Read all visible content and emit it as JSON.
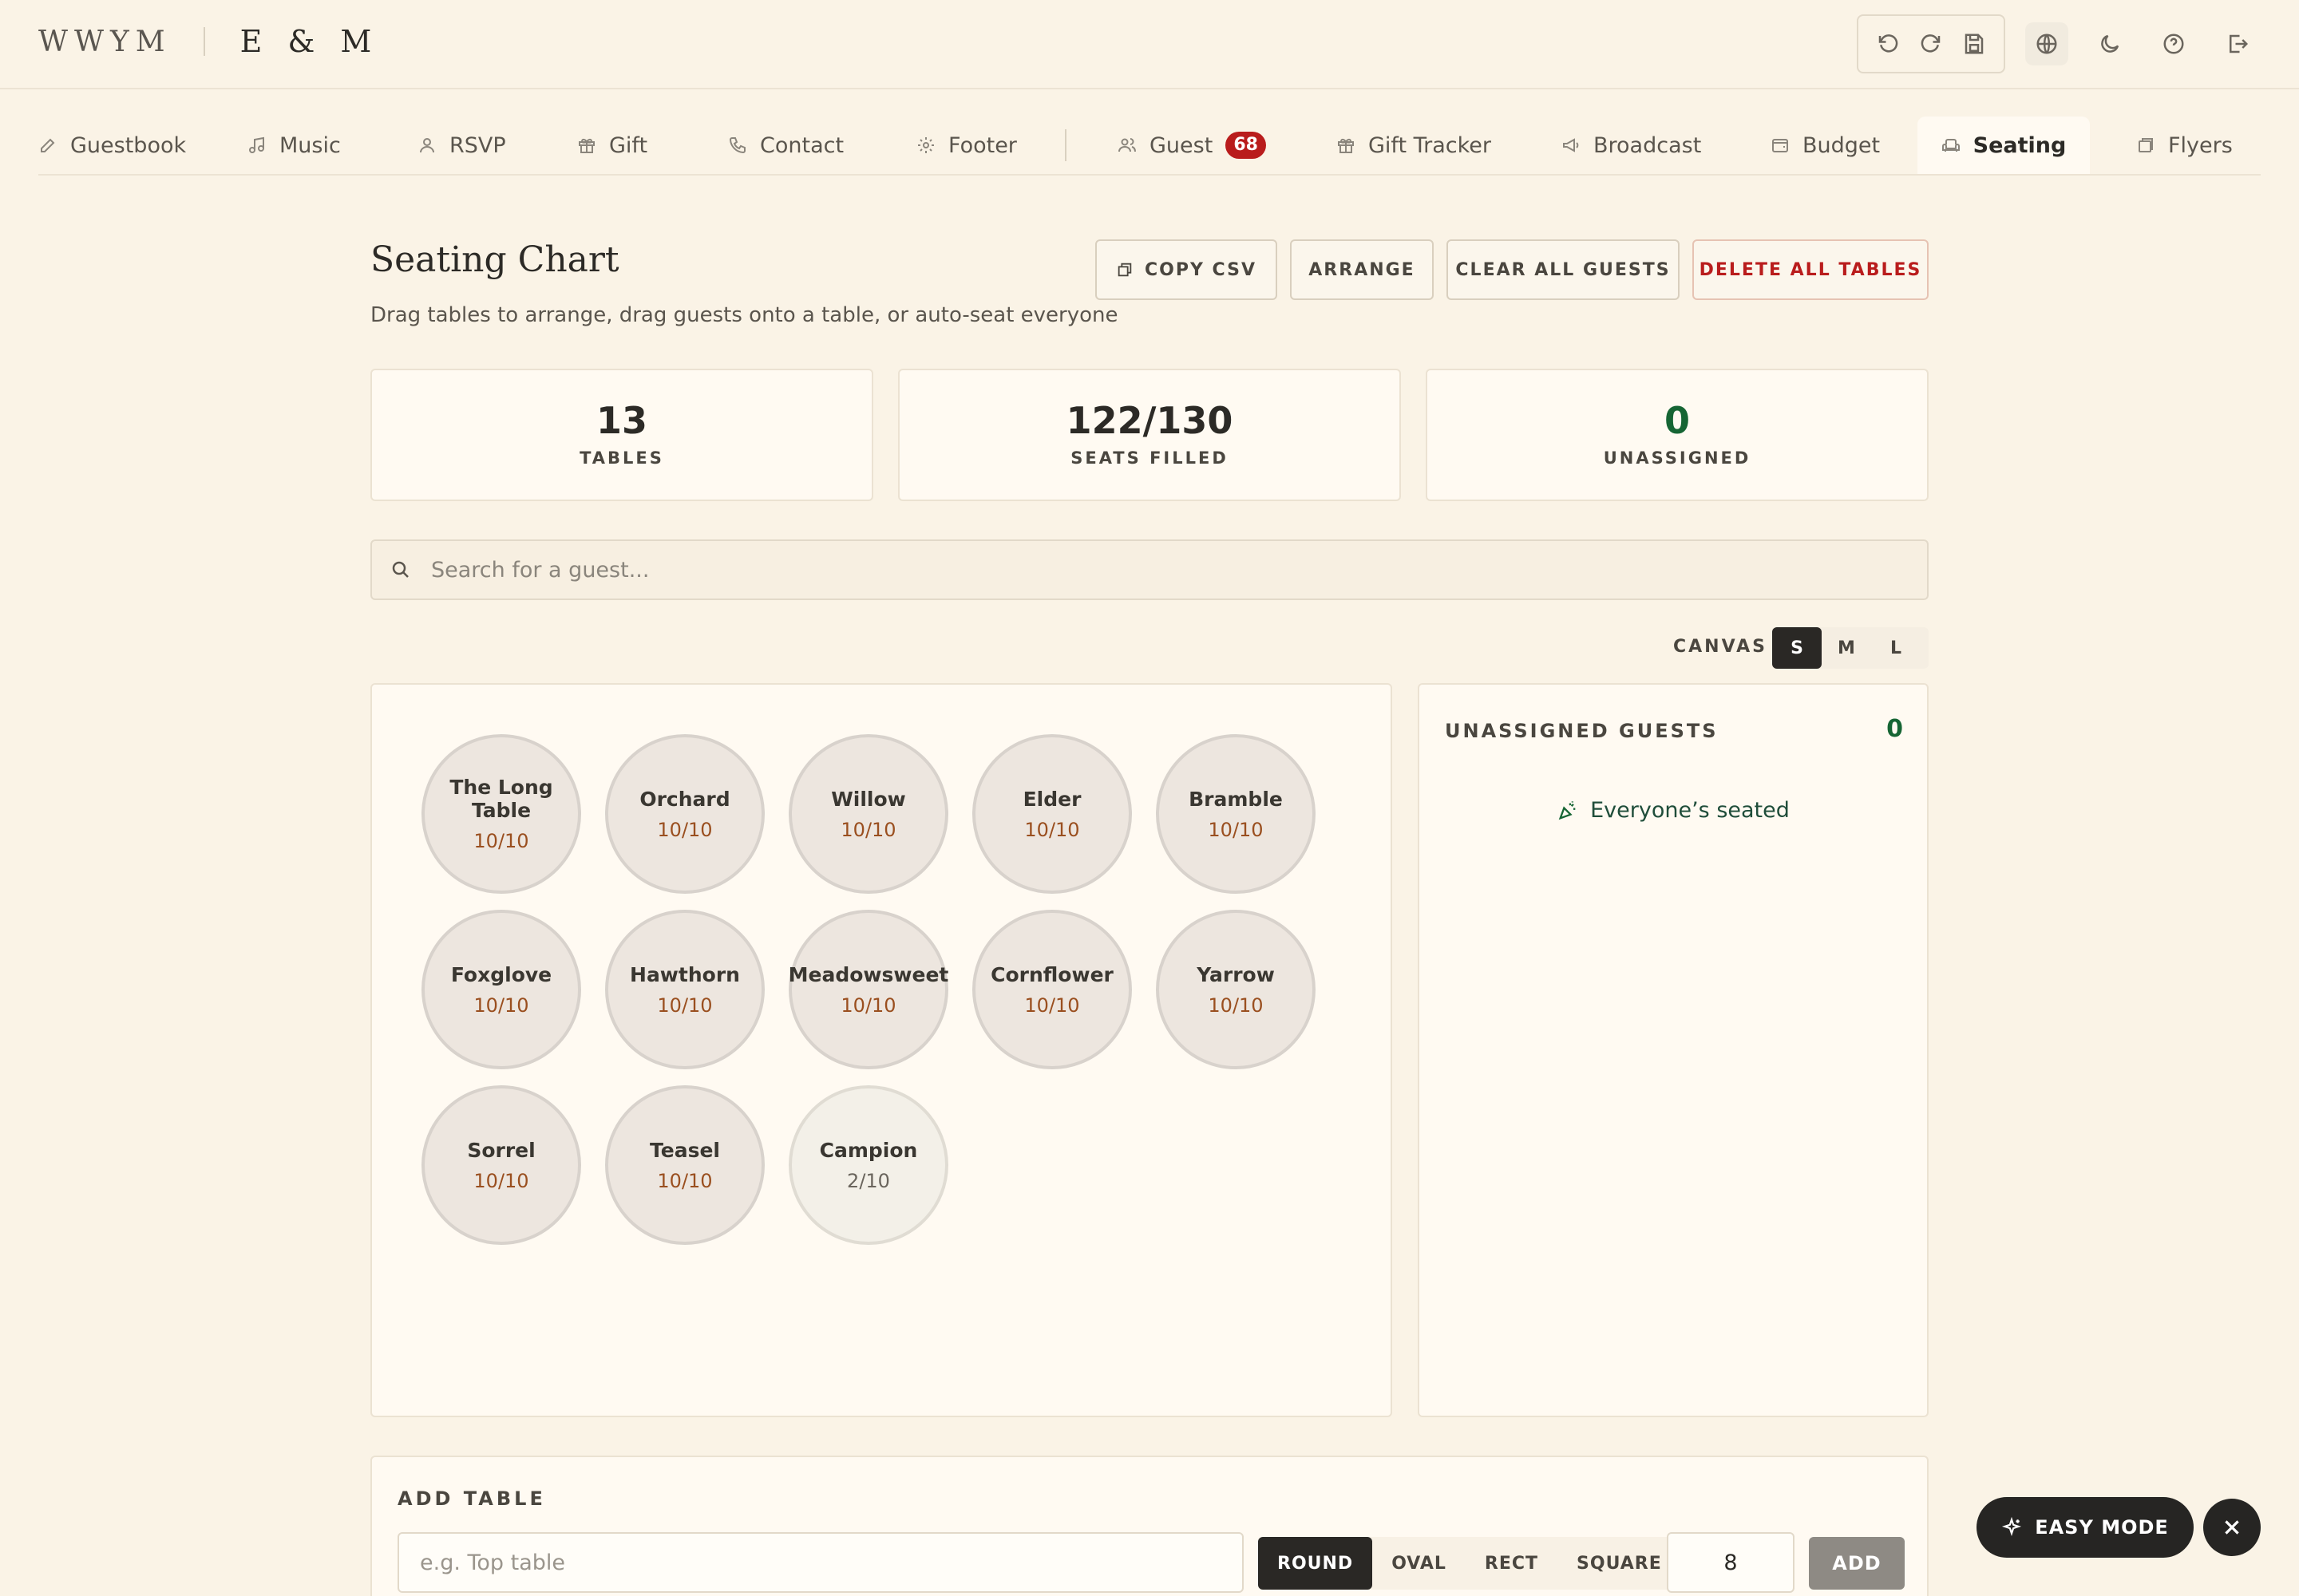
{
  "brand": {
    "primary": "WWYM",
    "couple": "E & M"
  },
  "toolbar": {
    "icons": [
      "undo-icon",
      "redo-icon",
      "save-icon",
      "globe-icon",
      "moon-icon",
      "help-icon",
      "logout-icon"
    ]
  },
  "tabs": [
    {
      "label": "Guestbook",
      "icon": "edit-icon"
    },
    {
      "label": "Music",
      "icon": "music-icon"
    },
    {
      "label": "RSVP",
      "icon": "user-icon"
    },
    {
      "label": "Gift",
      "icon": "gift-icon"
    },
    {
      "label": "Contact",
      "icon": "phone-icon"
    },
    {
      "label": "Footer",
      "icon": "settings-icon"
    },
    {
      "label": "Guest",
      "icon": "users-icon",
      "badge": "68"
    },
    {
      "label": "Gift Tracker",
      "icon": "gift-icon"
    },
    {
      "label": "Broadcast",
      "icon": "megaphone-icon"
    },
    {
      "label": "Budget",
      "icon": "wallet-icon"
    },
    {
      "label": "Seating",
      "icon": "armchair-icon",
      "active": true
    },
    {
      "label": "Flyers",
      "icon": "flyers-icon"
    }
  ],
  "header": {
    "title": "Seating Chart",
    "subtitle": "Drag tables to arrange, drag guests onto a table, or auto-seat everyone",
    "actions": {
      "copy_csv": "COPY CSV",
      "arrange": "ARRANGE",
      "clear_guests": "CLEAR ALL GUESTS",
      "delete_tables": "DELETE ALL TABLES"
    }
  },
  "stats": {
    "tables": {
      "value": "13",
      "label": "TABLES"
    },
    "seats": {
      "value": "122/130",
      "label": "SEATS FILLED"
    },
    "unassigned": {
      "value": "0",
      "label": "UNASSIGNED"
    }
  },
  "search": {
    "placeholder": "Search for a guest..."
  },
  "canvas": {
    "label": "CANVAS",
    "sizes": [
      "S",
      "M",
      "L"
    ],
    "selected": "S"
  },
  "tables": [
    {
      "name": "The Long Table",
      "count": "10/10"
    },
    {
      "name": "Orchard",
      "count": "10/10"
    },
    {
      "name": "Willow",
      "count": "10/10"
    },
    {
      "name": "Elder",
      "count": "10/10"
    },
    {
      "name": "Bramble",
      "count": "10/10"
    },
    {
      "name": "Foxglove",
      "count": "10/10"
    },
    {
      "name": "Hawthorn",
      "count": "10/10"
    },
    {
      "name": "Meadowsweet",
      "count": "10/10"
    },
    {
      "name": "Cornflower",
      "count": "10/10"
    },
    {
      "name": "Yarrow",
      "count": "10/10"
    },
    {
      "name": "Sorrel",
      "count": "10/10"
    },
    {
      "name": "Teasel",
      "count": "10/10"
    },
    {
      "name": "Campion",
      "count": "2/10"
    }
  ],
  "unassigned": {
    "title": "UNASSIGNED GUESTS",
    "count": "0",
    "empty_message": "Everyone’s seated"
  },
  "add_table": {
    "title": "ADD TABLE",
    "name_placeholder": "e.g. Top table",
    "shapes": [
      "ROUND",
      "OVAL",
      "RECT",
      "SQUARE"
    ],
    "selected_shape": "ROUND",
    "seats": "8",
    "add_label": "ADD"
  },
  "floating": {
    "easy_mode": "EASY MODE"
  },
  "colors": {
    "accent_dark": "#2a2825",
    "danger": "#b91c1c",
    "success": "#166534",
    "badge": "#b91c1c"
  }
}
